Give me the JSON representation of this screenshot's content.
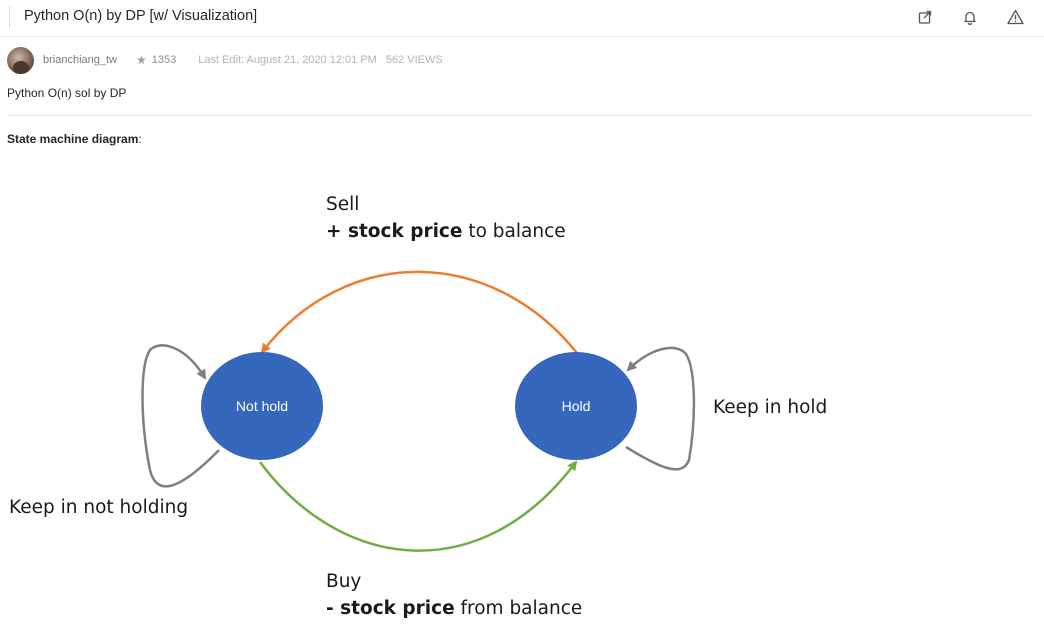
{
  "header": {
    "title": "Python O(n) by DP [w/ Visualization]",
    "icons": [
      "share-icon",
      "bell-icon",
      "warning-icon"
    ]
  },
  "author": {
    "username": "brianchiang_tw",
    "reputation": "1353",
    "last_edit": "Last Edit: August 21, 2020 12:01 PM",
    "views": "562 VIEWS"
  },
  "post": {
    "summary": "Python O(n) sol by DP",
    "section_heading_bold": "State machine diagram",
    "section_heading_suffix": ":"
  },
  "diagram": {
    "nodes": {
      "not_hold": "Not hold",
      "hold": "Hold"
    },
    "sell": {
      "line1": "Sell",
      "line2_prefix": "+ ",
      "line2_bold": "stock price",
      "line2_suffix": " to balance"
    },
    "buy": {
      "line1": "Buy",
      "line2_prefix": "- ",
      "line2_bold": "stock price",
      "line2_suffix": " from balance"
    },
    "keep_hold": "Keep in hold",
    "keep_not_holding": "Keep in not holding",
    "colors": {
      "node": "#3567bd",
      "sell_arrow": "#ed7d31",
      "buy_arrow": "#70ad47",
      "self_loop": "#7f7f7f"
    }
  }
}
